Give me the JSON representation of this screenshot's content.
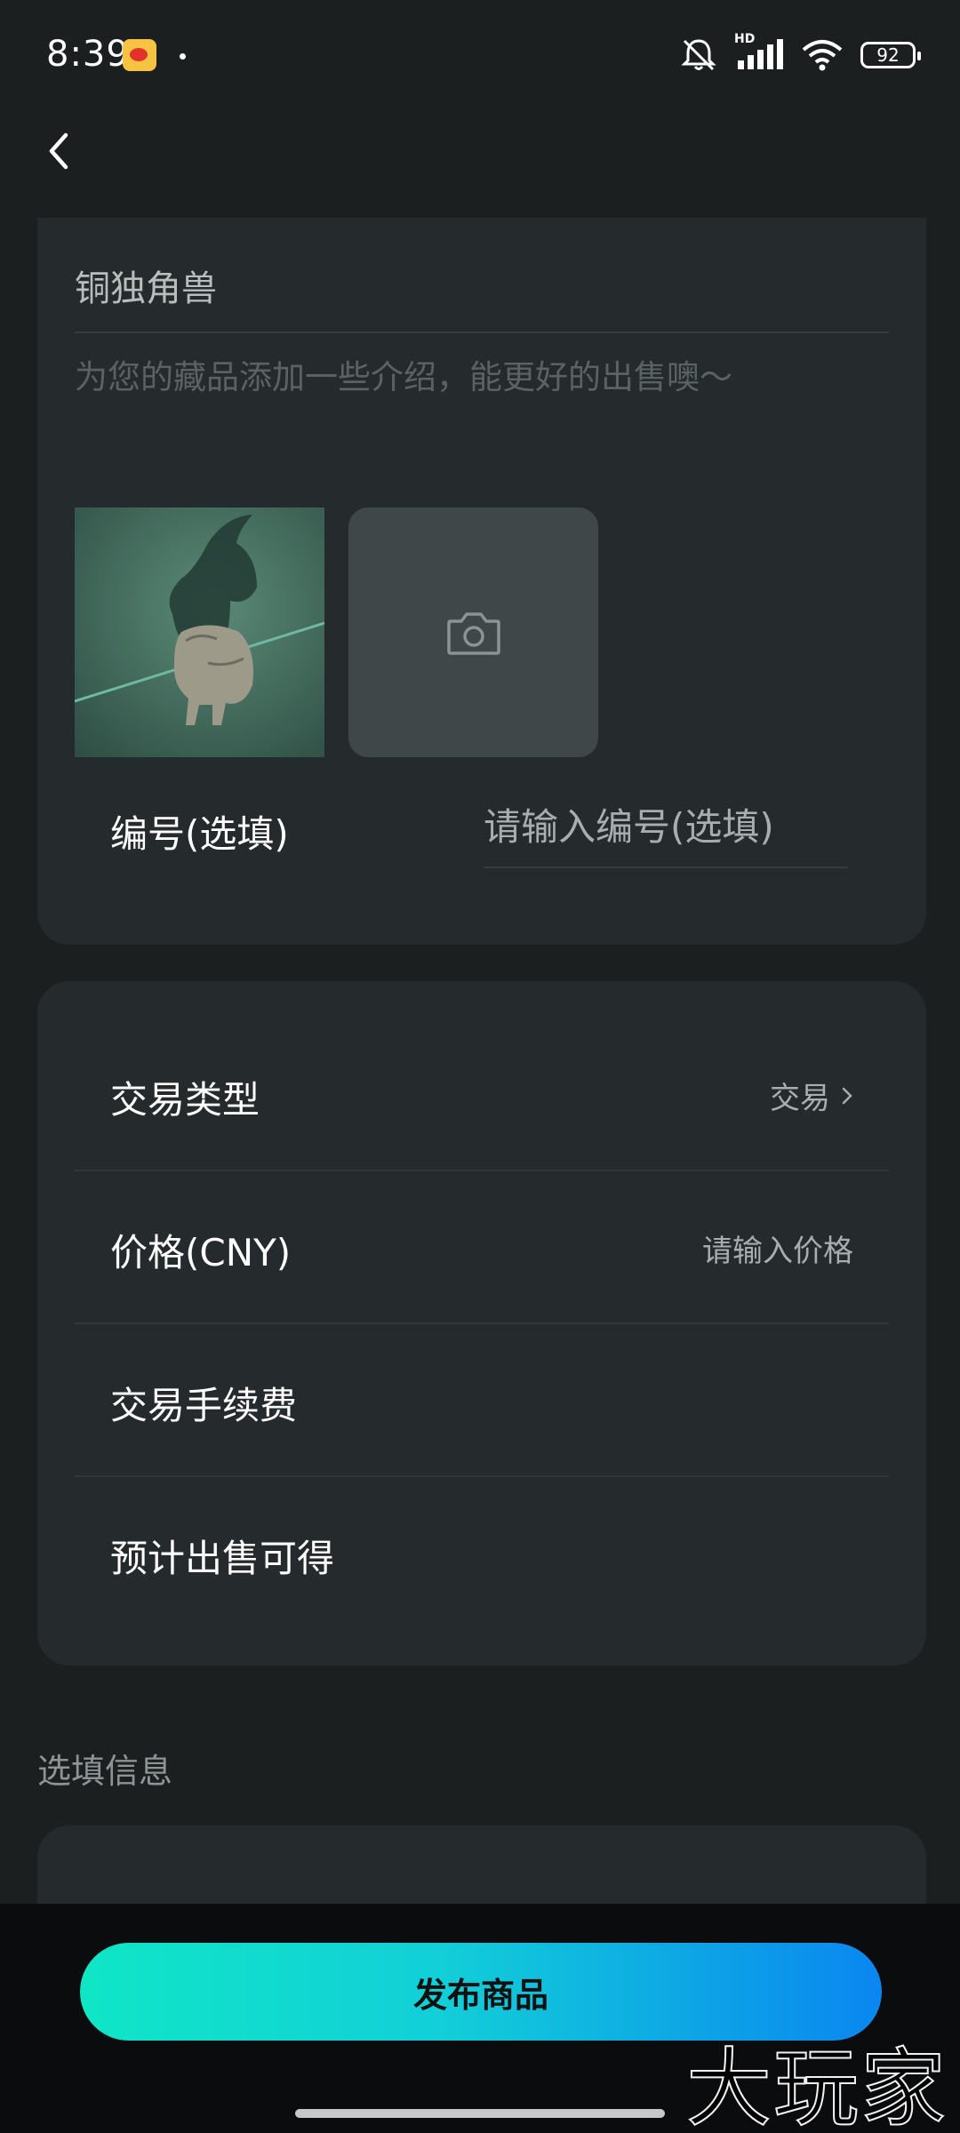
{
  "status_bar": {
    "time": "8:39",
    "battery": "92",
    "network_label": "HD",
    "icons": [
      "weibo-icon",
      "dot-icon",
      "mute-icon",
      "signal-icon",
      "wifi-icon",
      "battery-icon"
    ]
  },
  "nav": {
    "back_icon": "chevron-left-icon"
  },
  "item": {
    "name": "铜独角兽",
    "description_placeholder": "为您的藏品添加一些介绍，能更好的出售噢～",
    "add_photo_icon": "camera-icon",
    "serial_label": "编号(选填)",
    "serial_placeholder": "请输入编号(选填)"
  },
  "trade": {
    "rows": [
      {
        "label": "交易类型",
        "value": "交易"
      },
      {
        "label": "价格(CNY)",
        "value": "请输入价格"
      },
      {
        "label": "交易手续费",
        "value": ""
      },
      {
        "label": "预计出售可得",
        "value": ""
      }
    ]
  },
  "optional_section": {
    "title": "选填信息"
  },
  "footer": {
    "publish_label": "发布商品",
    "watermark": "大玩家"
  },
  "colors": {
    "background": "#1b1f20",
    "card": "#252b2c",
    "button_gradient_start": "#10e6c6",
    "button_gradient_end": "#0a86f0"
  }
}
